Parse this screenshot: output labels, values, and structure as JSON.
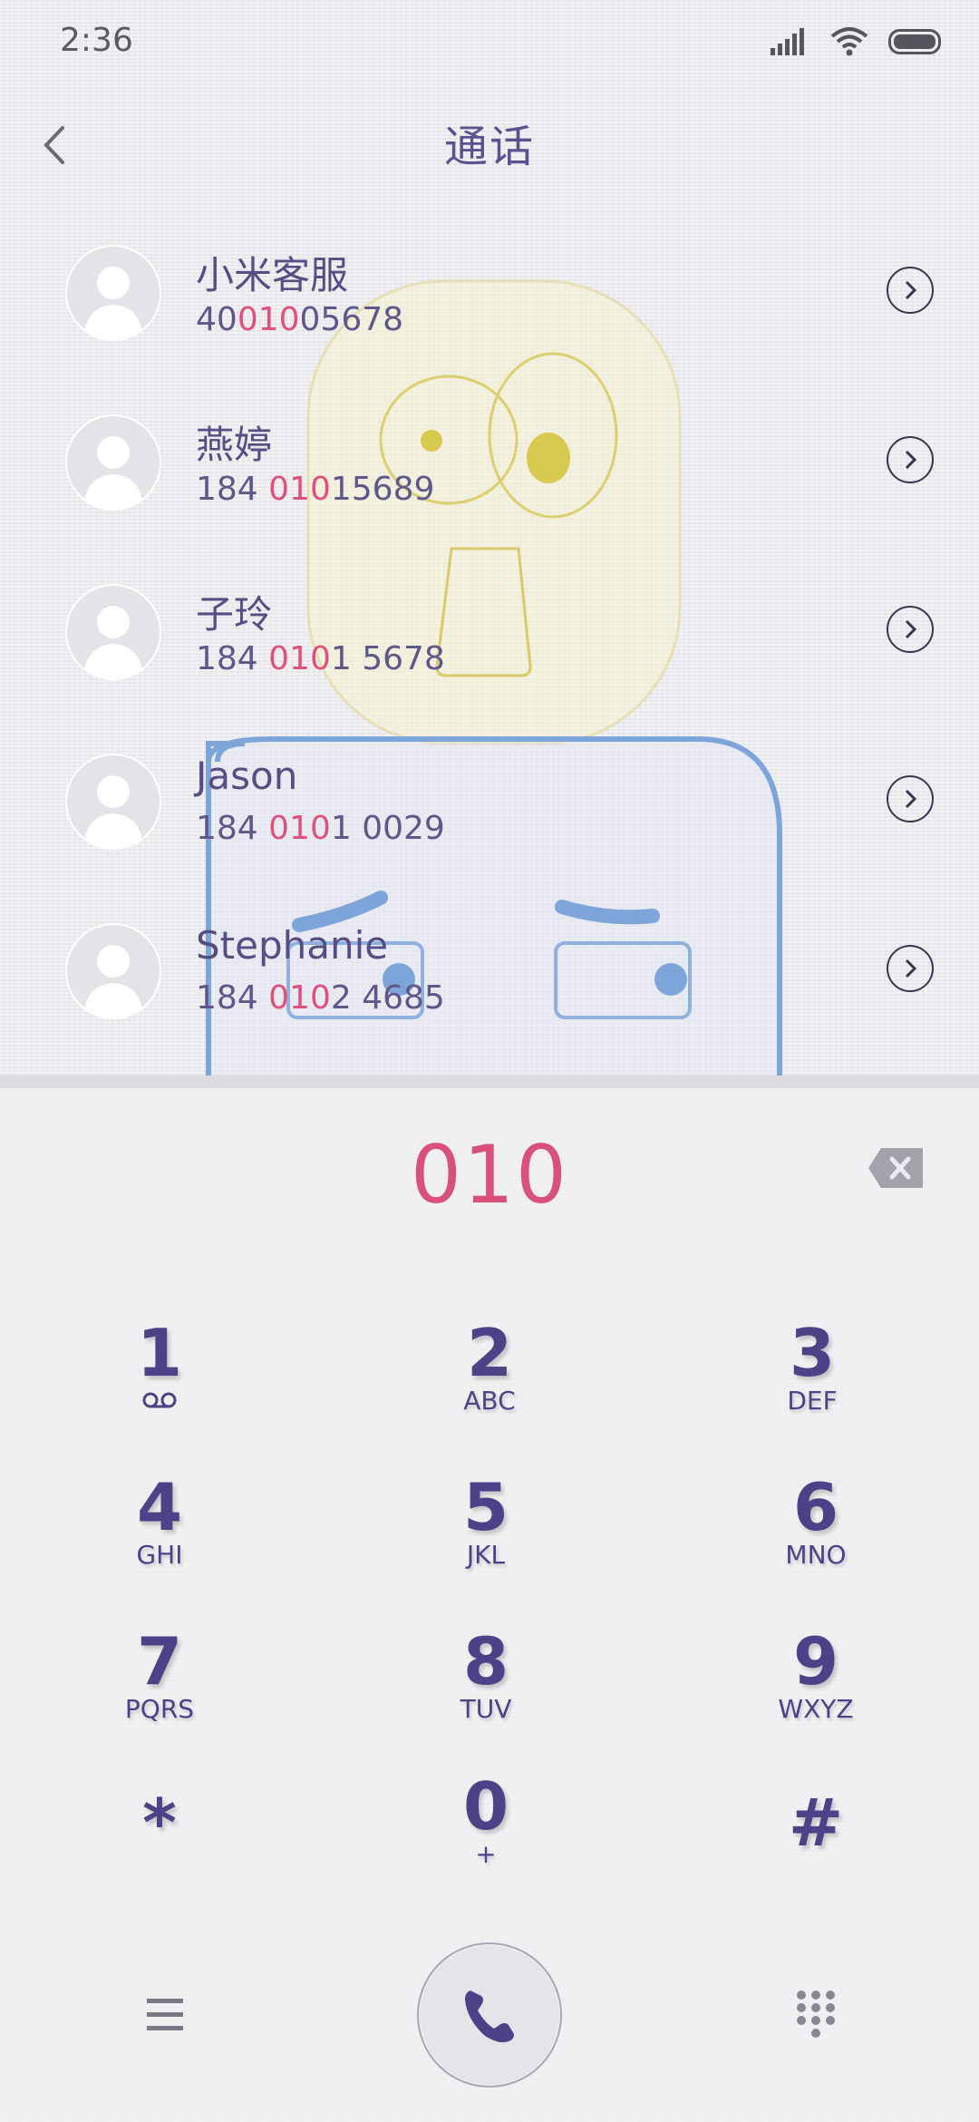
{
  "status_bar": {
    "time": "2:36"
  },
  "header": {
    "title": "通话"
  },
  "results": [
    {
      "name": "小米客服",
      "number_pre": "40",
      "number_match": "010",
      "number_post": "05678"
    },
    {
      "name": "燕婷",
      "number_pre": "184 ",
      "number_match": "010",
      "number_post": "15689"
    },
    {
      "name": "子玲",
      "number_pre": "184 ",
      "number_match": "010",
      "number_post": "1 5678"
    },
    {
      "name": "Jason",
      "number_pre": "184 ",
      "number_match": "010",
      "number_post": "1 0029"
    },
    {
      "name": "Stephanie",
      "number_pre": "184 ",
      "number_match": "010",
      "number_post": "2 4685"
    }
  ],
  "dialer": {
    "input": "010",
    "keys": [
      {
        "digit": "1",
        "letters": ""
      },
      {
        "digit": "2",
        "letters": "ABC"
      },
      {
        "digit": "3",
        "letters": "DEF"
      },
      {
        "digit": "4",
        "letters": "GHI"
      },
      {
        "digit": "5",
        "letters": "JKL"
      },
      {
        "digit": "6",
        "letters": "MNO"
      },
      {
        "digit": "7",
        "letters": "PQRS"
      },
      {
        "digit": "8",
        "letters": "TUV"
      },
      {
        "digit": "9",
        "letters": "WXYZ"
      },
      {
        "digit": "*",
        "letters": ""
      },
      {
        "digit": "0",
        "letters": "+"
      },
      {
        "digit": "#",
        "letters": ""
      }
    ]
  },
  "colors": {
    "accent": "#d9517a",
    "primary": "#4d4287"
  },
  "icons": [
    "signal-icon",
    "wifi-icon",
    "battery-icon",
    "back-arrow-icon",
    "detail-chevron-icon",
    "backspace-icon",
    "voicemail-icon",
    "menu-icon",
    "phone-icon",
    "dialpad-grid-icon"
  ]
}
